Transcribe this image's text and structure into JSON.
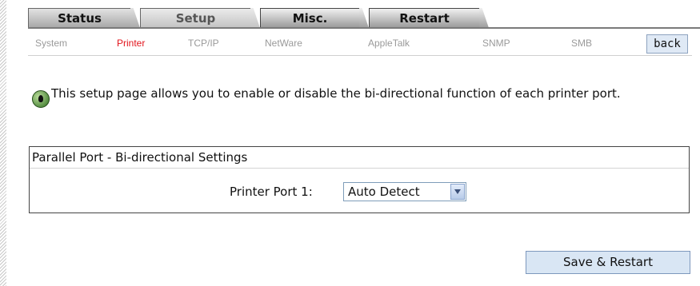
{
  "tabs": [
    {
      "label": "Status"
    },
    {
      "label": "Setup"
    },
    {
      "label": "Misc."
    },
    {
      "label": "Restart"
    }
  ],
  "subnav": {
    "items": [
      "System",
      "Printer",
      "TCP/IP",
      "NetWare",
      "AppleTalk",
      "SNMP",
      "SMB"
    ],
    "active": "Printer",
    "back_label": "back"
  },
  "info": {
    "icon": "info-leaf-icon",
    "text": "This setup page allows you to enable or disable the bi-directional function of each printer port."
  },
  "panel": {
    "title": "Parallel Port - Bi-directional Settings",
    "port_label": "Printer Port 1:",
    "port_value": "Auto Detect"
  },
  "actions": {
    "save_label": "Save & Restart"
  },
  "colors": {
    "active_link": "#e2141c",
    "inactive_link": "#9a9a9a",
    "button_bg": "#d9e6f4"
  }
}
